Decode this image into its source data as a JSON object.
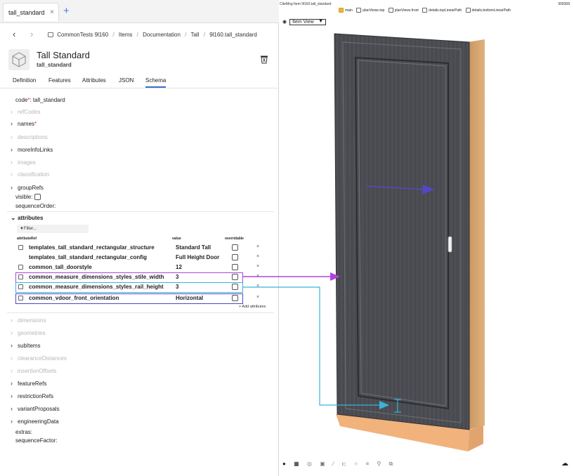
{
  "tab": {
    "label": "tall_standard",
    "close": "×",
    "add": "+"
  },
  "nav": {
    "back": "‹",
    "forward": "›",
    "breadcrumb": [
      "CommonTests 9l160",
      "Items",
      "Documentation",
      "Tall",
      "9l160.tall_standard"
    ],
    "sep": "/"
  },
  "item": {
    "title": "Tall Standard",
    "code": "tall_standard"
  },
  "subtabs": [
    "Definition",
    "Features",
    "Attributes",
    "JSON",
    "Schema"
  ],
  "schema": {
    "code_label": "code",
    "code_req": "*",
    "code_value": ": tall_standard",
    "refCodes": "refCodes",
    "names": "names",
    "names_req": "*",
    "descriptions": "descriptions",
    "moreInfoLinks": "moreInfoLinks",
    "images": "images",
    "classification": "classification",
    "groupRefs": "groupRefs",
    "visible": "visible:",
    "sequenceOrder": "sequenceOrder:",
    "attributes": "attributes",
    "filter": "Filter...",
    "col_ref": "attributeRef",
    "col_value": "value",
    "col_overridable": "overridable",
    "add_attributes": "+ Add attributes",
    "dimensions": "dimensions",
    "geometries": "geometries",
    "subItems": "subItems",
    "clearanceDistances": "clearanceDistances",
    "insertionOffsets": "insertionOffsets",
    "featureRefs": "featureRefs",
    "restrictionRefs": "restrictionRefs",
    "variantProposals": "variantProposals",
    "engineeringData": "engineeringData",
    "extras": "extras:",
    "sequenceFactor": "sequenceFactor:"
  },
  "attribute_rows": [
    {
      "ref": "templates_tall_standard_rectangular_structure",
      "value": "Standard Tall",
      "delete": "×"
    },
    {
      "ref": "templates_tall_standard_rectangular_config",
      "value": "Full Height Door",
      "delete": "×"
    },
    {
      "ref": "common_tall_doorstyle",
      "value": "12",
      "delete": "×"
    },
    {
      "ref": "common_measure_dimensions_styles_stile_width",
      "value": "3",
      "delete": "×"
    },
    {
      "ref": "common_measure_dimensions_styles_rail_height",
      "value": "3",
      "delete": "×"
    },
    {
      "ref": "common_vdoor_front_orientation",
      "value": "Horizontal",
      "delete": "×"
    }
  ],
  "viewer": {
    "title": "CiteMng Item 9l160.tall_standard",
    "size": "958368",
    "views": [
      "main",
      "planViews.top",
      "planViews.front",
      "details.topLinearPath",
      "details.bottomLinearPath"
    ],
    "view_select": "Item View",
    "view_select_arrow": "▼"
  },
  "colors": {
    "highlight_purple": "#b142e0",
    "highlight_teal": "#3ab3d8",
    "highlight_indigo": "#5646c8",
    "cabinet_gray": "#4a4c52",
    "cabinet_wood": "#d9a870",
    "accent": "#f0b43a"
  }
}
